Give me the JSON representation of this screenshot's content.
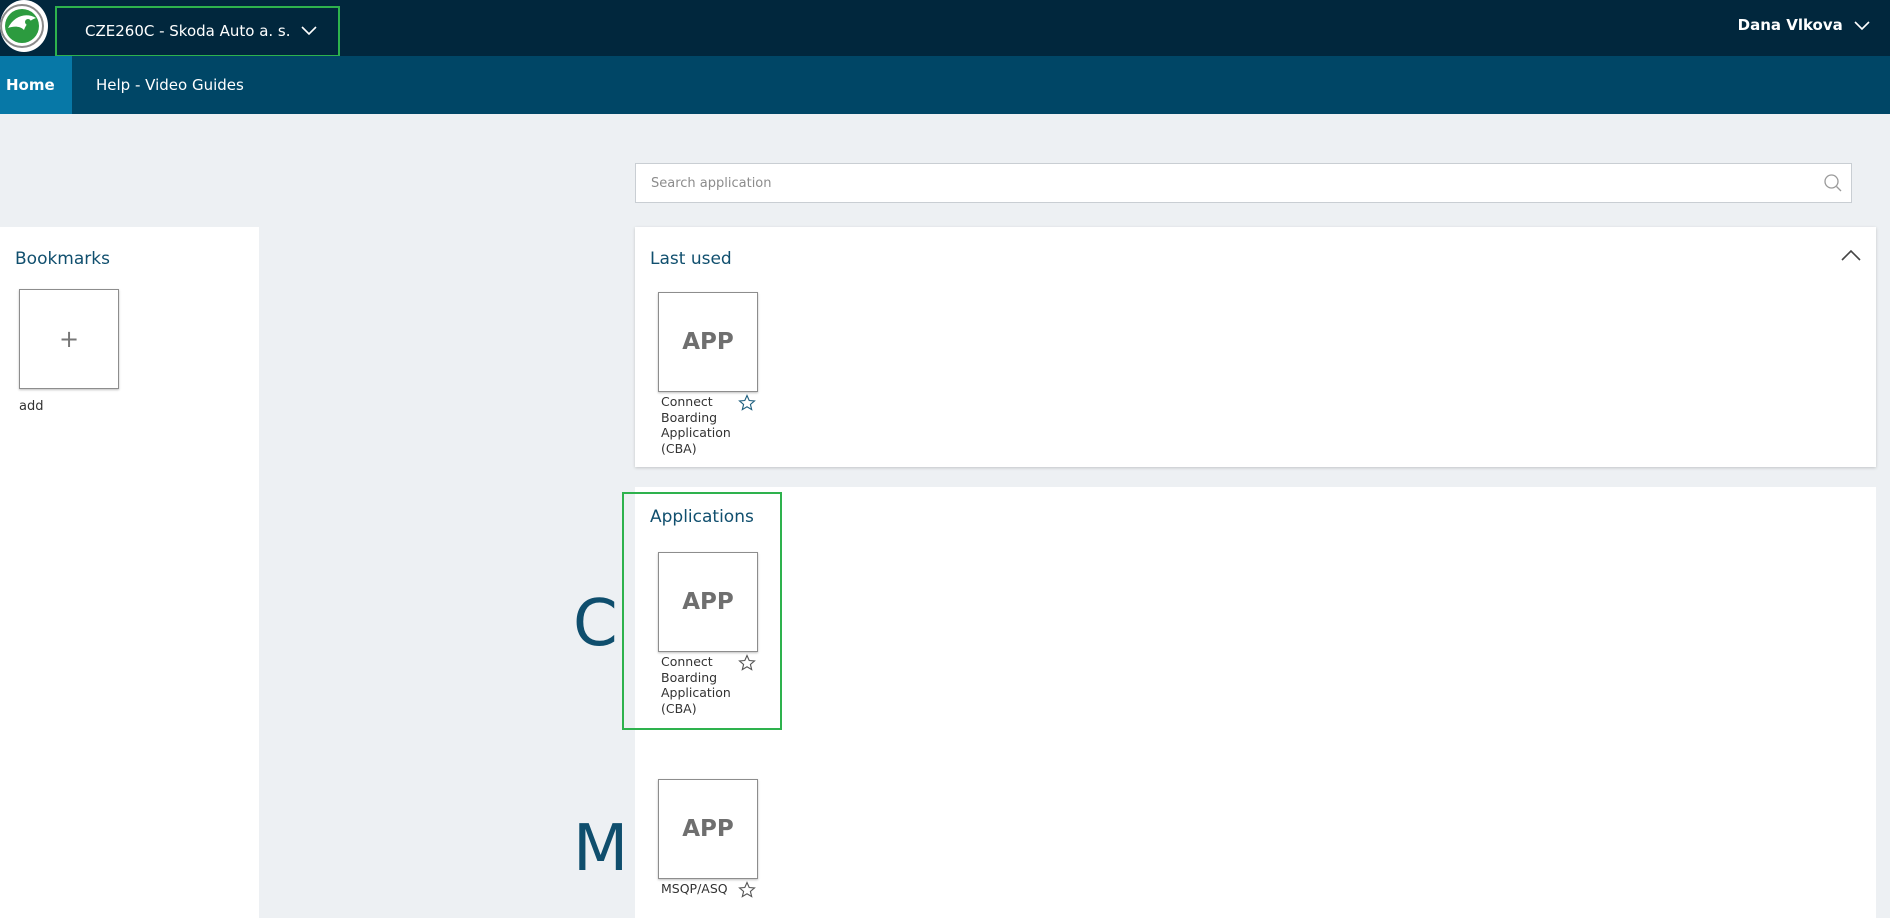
{
  "header": {
    "dealer": "CZE260C - Skoda Auto a. s.",
    "user": "Dana Vlkova"
  },
  "nav": {
    "home": "Home",
    "help": "Help - Video Guides"
  },
  "search": {
    "placeholder": "Search application"
  },
  "bookmarks": {
    "title": "Bookmarks",
    "add_symbol": "+",
    "add_label": "add"
  },
  "background_letters": [
    "C",
    "M"
  ],
  "last_used": {
    "title": "Last used",
    "apps": [
      {
        "tile": "APP",
        "label": "Connect Boarding Application (CBA)"
      }
    ]
  },
  "applications": {
    "title": "Applications",
    "apps": [
      {
        "tile": "APP",
        "label": "Connect Boarding Application (CBA)"
      },
      {
        "tile": "APP",
        "label": "MSQP/ASQ"
      }
    ]
  },
  "colors": {
    "topbar": "#01273d",
    "navbar": "#004666",
    "nav_active": "#0778a7",
    "highlight": "#2eb24d",
    "title": "#104f6e"
  },
  "icons": [
    "skoda-logo-icon",
    "chevron-down-icon",
    "search-icon",
    "plus-icon",
    "chevron-up-icon",
    "star-icon"
  ]
}
